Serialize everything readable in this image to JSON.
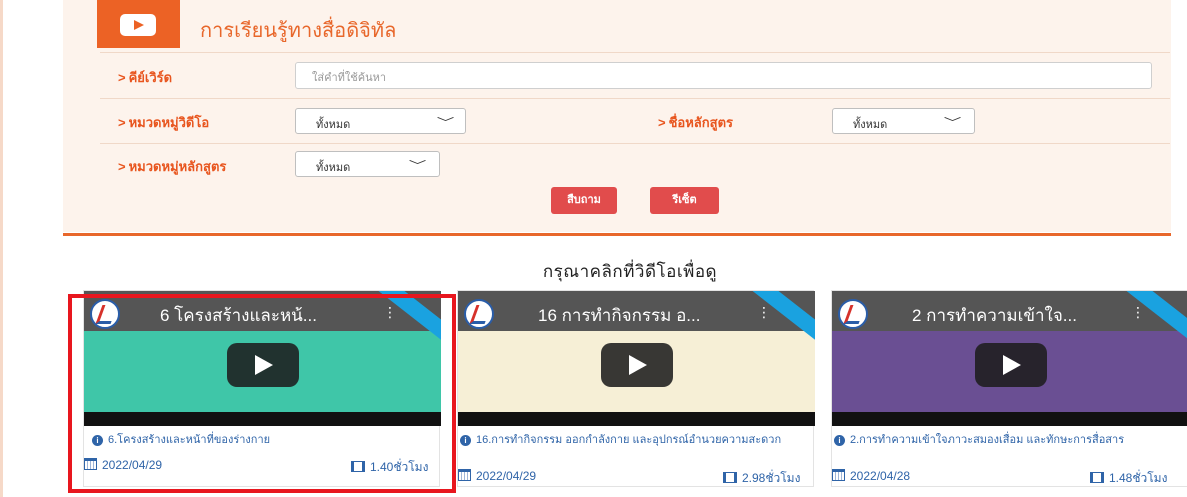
{
  "header": {
    "title": "การเรียนรู้ทางสื่อดิจิทัล",
    "icon": "youtube-play-icon"
  },
  "search": {
    "keyword_label": "คีย์เวิร์ด",
    "keyword_placeholder": "ใส่คำที่ใช้ค้นหา",
    "video_category_label": "หมวดหมู่วิดีโอ",
    "video_category_value": "ทั้งหมด",
    "course_label": "ชื่อหลักสูตร",
    "course_value": "ทั้งหมด",
    "course_category_label": "หมวดหมู่หลักสูตร",
    "course_category_value": "ทั้งหมด",
    "search_button": "สืบถาม",
    "reset_button": "รีเซ็ต"
  },
  "prompt": "กรุณาคลิกที่วิดีโอเพื่อดู",
  "videos": [
    {
      "thumb_title": "6 โครงสร้างและหน้...",
      "title": "6.โครงสร้างและหน้าที่ของร่างกาย",
      "date": "2022/04/29",
      "duration": "1.40ชั่วโมง"
    },
    {
      "thumb_title": "16 การทำกิจกรรม อ...",
      "title": "16.การทำกิจกรรม ออกกำลังกาย และอุปกรณ์อำนวยความสะดวก",
      "date": "2022/04/29",
      "duration": "2.98ชั่วโมง"
    },
    {
      "thumb_title": "2 การทำความเข้าใจ...",
      "title": "2.การทำความเข้าใจภาวะสมองเสื่อม และทักษะการสื่อสาร",
      "date": "2022/04/28",
      "duration": "1.48ชั่วโมง"
    }
  ],
  "colors": {
    "accent": "#ec6225",
    "panel_bg": "#fdf3ec",
    "button": "#e14c4c",
    "link": "#2f64a8",
    "highlight": "#e8161e"
  }
}
